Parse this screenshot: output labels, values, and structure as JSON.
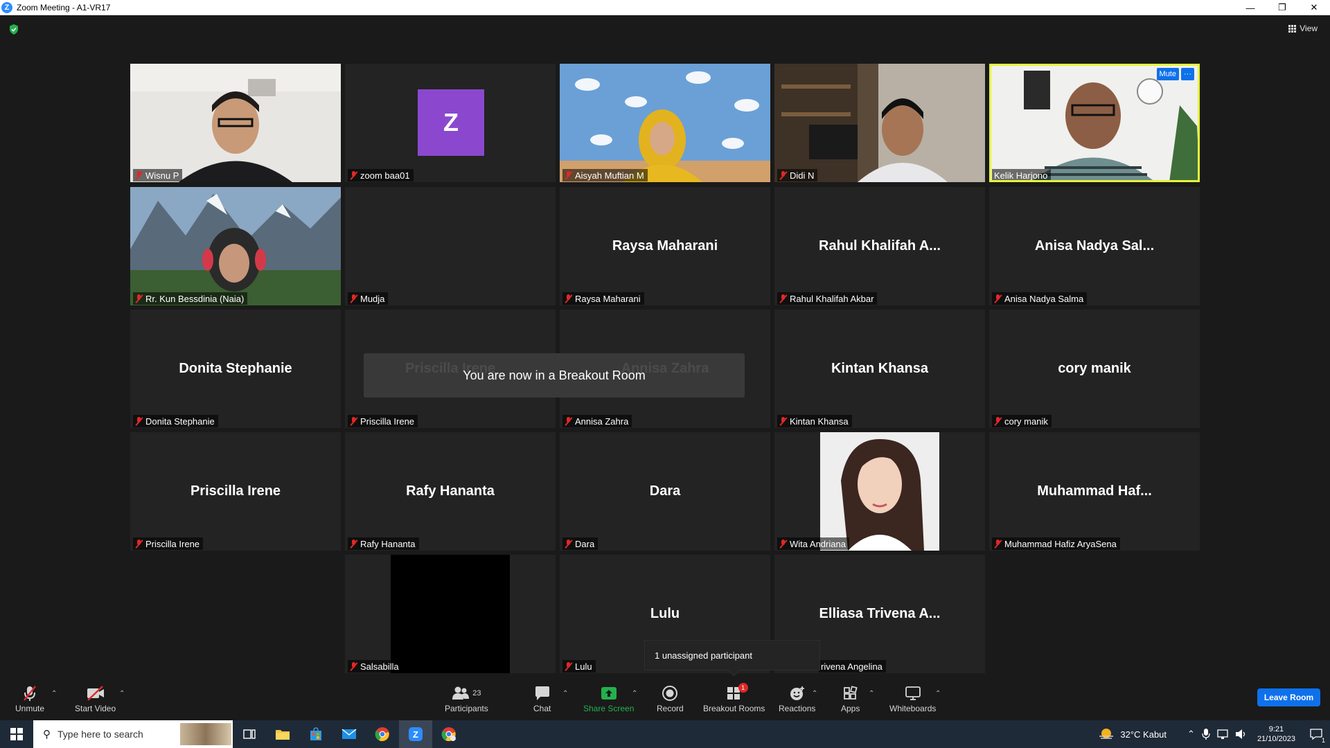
{
  "window": {
    "title": "Zoom Meeting - A1-VR17"
  },
  "header": {
    "view_label": "View"
  },
  "tiles": [
    {
      "name": "Wisnu P",
      "display": "",
      "kind": "video"
    },
    {
      "name": "zoom baa01",
      "display": "",
      "kind": "avatar",
      "avatar_letter": "Z"
    },
    {
      "name": "Aisyah Muftian M",
      "display": "",
      "kind": "video"
    },
    {
      "name": "Didi N",
      "display": "",
      "kind": "video"
    },
    {
      "name": "Kelik Harjono",
      "display": "",
      "kind": "video",
      "active": true,
      "buttons": [
        "Mute",
        "···"
      ]
    },
    {
      "name": "Rr. Kun Bessdinia (Naia)",
      "display": "",
      "kind": "video"
    },
    {
      "name": "Mudja",
      "display": "",
      "kind": "blank"
    },
    {
      "name": "Raysa Maharani",
      "display": "Raysa Maharani",
      "kind": "name"
    },
    {
      "name": "Rahul Khalifah Akbar",
      "display": "Rahul  Khalifah  A...",
      "kind": "name"
    },
    {
      "name": "Anisa Nadya Salma",
      "display": "Anisa  Nadya  Sal...",
      "kind": "name"
    },
    {
      "name": "Donita Stephanie",
      "display": "Donita Stephanie",
      "kind": "name"
    },
    {
      "name": "Priscilla Irene",
      "display": "Priscilla Irene",
      "kind": "name"
    },
    {
      "name": "Annisa Zahra",
      "display": "Annisa Zahra",
      "kind": "name"
    },
    {
      "name": "Kintan Khansa",
      "display": "Kintan Khansa",
      "kind": "name"
    },
    {
      "name": "cory manik",
      "display": "cory manik",
      "kind": "name"
    },
    {
      "name": "Priscilla Irene",
      "display": "Priscilla Irene",
      "kind": "name"
    },
    {
      "name": "Rafy Hananta",
      "display": "Rafy Hananta",
      "kind": "name"
    },
    {
      "name": "Dara",
      "display": "Dara",
      "kind": "name"
    },
    {
      "name": "Wita Andriana",
      "display": "",
      "kind": "photo"
    },
    {
      "name": "Muhammad Hafiz AryaSena",
      "display": "Muhammad  Haf...",
      "kind": "name"
    },
    {
      "name": "Salsabilla",
      "display": "",
      "kind": "black"
    },
    {
      "name": "Lulu",
      "display": "Lulu",
      "kind": "name"
    },
    {
      "name": "rivena Angelina",
      "display": "Elliasa  Trivena  A...",
      "kind": "name"
    }
  ],
  "notification": {
    "text": "You are now in a Breakout Room"
  },
  "tooltip": {
    "text": "1 unassigned participant"
  },
  "toolbar": {
    "unmute": "Unmute",
    "start_video": "Start Video",
    "participants": "Participants",
    "participants_count": "23",
    "chat": "Chat",
    "share_screen": "Share Screen",
    "record": "Record",
    "breakout_rooms": "Breakout Rooms",
    "breakout_badge": "1",
    "reactions": "Reactions",
    "apps": "Apps",
    "whiteboards": "Whiteboards",
    "leave": "Leave Room"
  },
  "taskbar": {
    "search_placeholder": "Type here to search",
    "weather": "32°C  Kabut",
    "time": "9:21",
    "date": "21/10/2023",
    "notification_count": "1"
  },
  "colors": {
    "accent": "#0e71eb",
    "share_green": "#23b14d",
    "muted_red": "#e02828",
    "active_speaker": "#e6f43b",
    "avatar_purple": "#8b48ce"
  }
}
